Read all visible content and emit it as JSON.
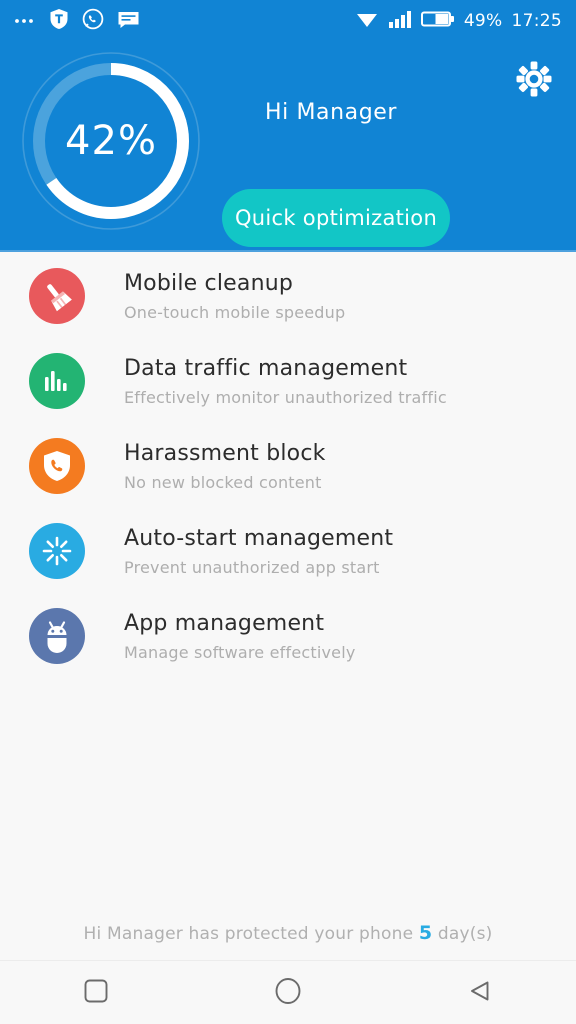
{
  "statusbar": {
    "left_icons": [
      "more-dots-icon",
      "shield-icon",
      "whatsapp-icon",
      "message-icon"
    ],
    "right_icons": [
      "wifi-icon",
      "cellular-signal-icon",
      "battery-icon"
    ],
    "battery_level": "49%",
    "clock": "17:25"
  },
  "header": {
    "bg_color": "#1184d4",
    "gear_icon": "gear-icon",
    "score_percent": "42%",
    "score_value": 42,
    "greeting": "Hi Manager",
    "quick_button_label": "Quick optimization",
    "quick_button_color": "#12c6c6"
  },
  "list": {
    "items": [
      {
        "icon": "broom-icon",
        "icon_color": "#e8595c",
        "title": "Mobile cleanup",
        "subtitle": "One-touch mobile speedup"
      },
      {
        "icon": "bar-chart-icon",
        "icon_color": "#23b473",
        "title": "Data traffic management",
        "subtitle": "Effectively monitor unauthorized traffic"
      },
      {
        "icon": "shield-phone-icon",
        "icon_color": "#f47b20",
        "title": "Harassment block",
        "subtitle": "No new blocked content"
      },
      {
        "icon": "starburst-icon",
        "icon_color": "#29abe2",
        "title": "Auto-start management",
        "subtitle": "Prevent unauthorized app start"
      },
      {
        "icon": "android-robot-icon",
        "icon_color": "#5b77ad",
        "title": "App management",
        "subtitle": "Manage software effectively"
      }
    ]
  },
  "footer": {
    "prefix": "Hi Manager has protected your phone",
    "days": "5",
    "suffix": "day(s)",
    "days_color": "#29abe2"
  },
  "navbar": {
    "recents_label": "recents-square-icon",
    "home_label": "home-circle-icon",
    "back_label": "back-triangle-icon"
  }
}
